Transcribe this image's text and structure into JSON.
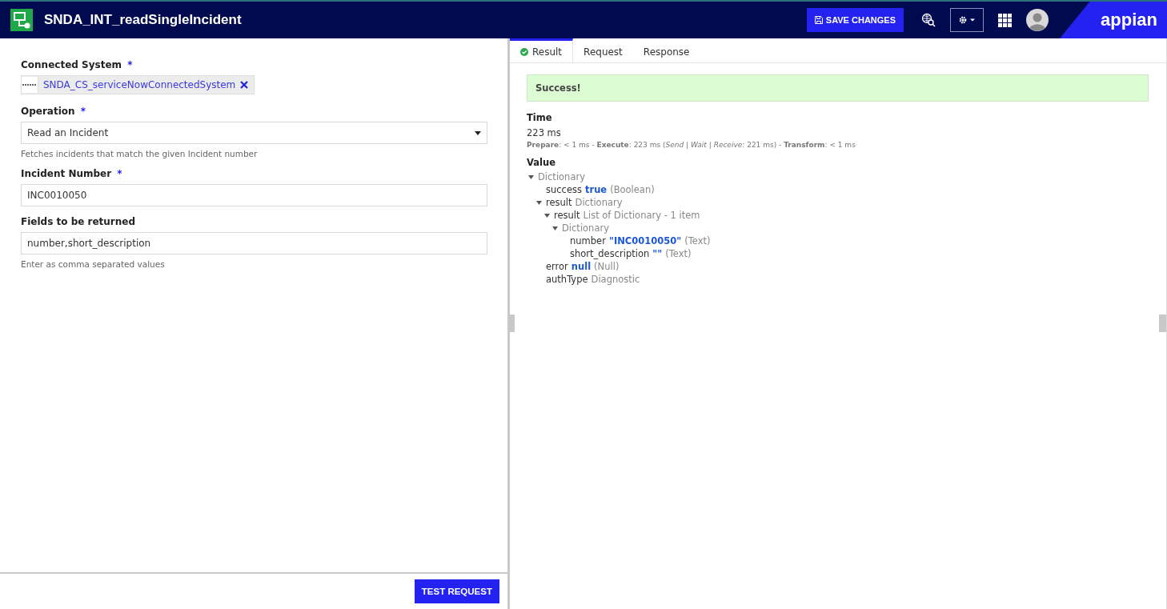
{
  "header": {
    "title": "SNDA_INT_readSingleIncident",
    "save_button": "SAVE CHANGES",
    "logo": "appian"
  },
  "form": {
    "fields": [
      {
        "kind": "chip",
        "label": "Connected System",
        "required_mark": "*",
        "value": "SNDA_CS_serviceNowConnectedSystem"
      },
      {
        "kind": "dropdown",
        "label": "Operation",
        "required_mark": "*",
        "value": "Read an Incident",
        "help": "Fetches incidents that match the given Incident number"
      },
      {
        "kind": "text",
        "label": "Incident Number",
        "required_mark": "*",
        "value": "INC0010050"
      },
      {
        "kind": "text",
        "label": "Fields to be returned",
        "value": "number,short_description",
        "help": "Enter as comma separated values"
      }
    ],
    "test_button": "TEST REQUEST"
  },
  "result_panel": {
    "tabs": [
      {
        "label": "Result",
        "selected": true,
        "success": true
      },
      {
        "label": "Request",
        "selected": false,
        "success": false
      },
      {
        "label": "Response",
        "selected": false,
        "success": false
      }
    ],
    "message": "Success!",
    "time_heading": "Time",
    "time": "223 ms",
    "time_breakdown": "**Prepare**: < 1 ms - **Execute**: 223 ms (*Send | Wait | Receive*: 221 ms) - **Transform**: < 1 ms",
    "value_heading": "Value",
    "tree": [
      {
        "type": "Dictionary",
        "expanded": true,
        "children": [
          {
            "key": "success",
            "value": "true",
            "type": "(Boolean)"
          },
          {
            "key": "result",
            "type": "Dictionary",
            "expanded": true,
            "children": [
              {
                "key": "result",
                "type": "List of Dictionary - 1 item",
                "expanded": true,
                "children": [
                  {
                    "type": "Dictionary",
                    "expanded": true,
                    "children": [
                      {
                        "key": "number",
                        "value": "\"INC0010050\"",
                        "type": "(Text)"
                      },
                      {
                        "key": "short_description",
                        "value": "\"\"",
                        "type": "(Text)"
                      }
                    ]
                  }
                ]
              }
            ]
          },
          {
            "key": "error",
            "value": "null",
            "type": "(Null)"
          },
          {
            "key": "authType",
            "type": "Diagnostic"
          }
        ]
      }
    ]
  }
}
